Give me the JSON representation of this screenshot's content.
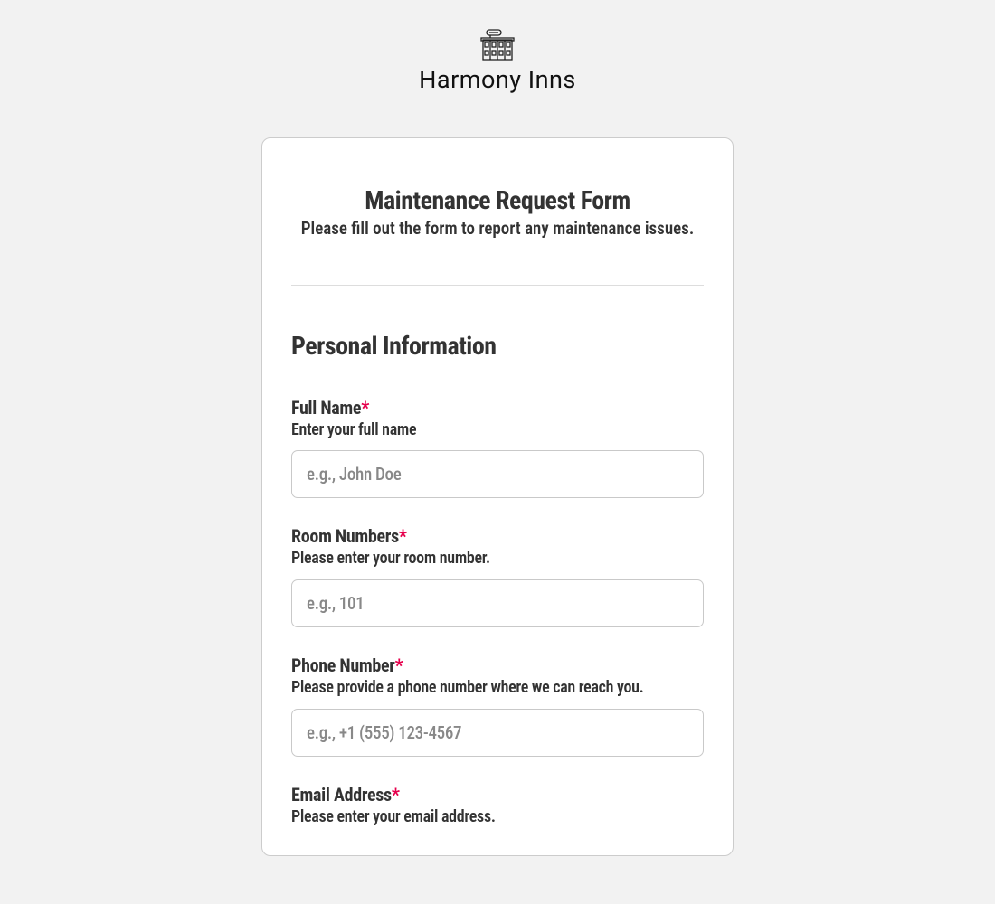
{
  "brand": {
    "name": "Harmony Inns"
  },
  "form": {
    "title": "Maintenance Request Form",
    "subtitle": "Please fill out the form to report any maintenance issues.",
    "sections": {
      "personal": {
        "title": "Personal Information",
        "fields": {
          "fullName": {
            "label": "Full Name",
            "required": "*",
            "sublabel": "Enter your full name",
            "placeholder": "e.g., John Doe"
          },
          "roomNumbers": {
            "label": "Room Numbers",
            "required": "*",
            "sublabel": "Please enter your room number.",
            "placeholder": "e.g., 101"
          },
          "phoneNumber": {
            "label": "Phone Number",
            "required": "*",
            "sublabel": "Please provide a phone number where we can reach you.",
            "placeholder": "e.g., +1 (555) 123-4567"
          },
          "emailAddress": {
            "label": "Email Address",
            "required": "*",
            "sublabel": "Please enter your email address."
          }
        }
      }
    }
  }
}
